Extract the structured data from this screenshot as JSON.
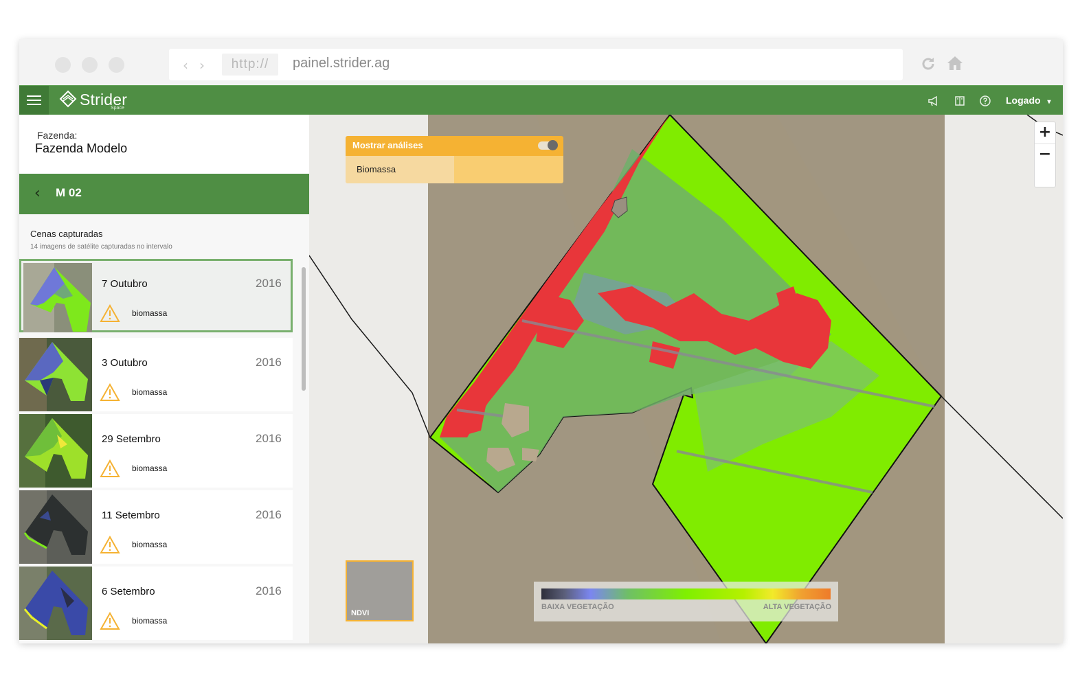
{
  "browser": {
    "protocol": "http://",
    "url": "painel.strider.ag"
  },
  "appbar": {
    "brand": "Strider",
    "brand_sub": "Space",
    "user_label": "Logado",
    "user_caret": "▾",
    "icons": [
      "megaphone-icon",
      "book-icon",
      "help-icon"
    ]
  },
  "sidebar": {
    "farm_label": "Fazenda:",
    "farm_name": "Fazenda Modelo",
    "field_back": "‹",
    "field_name": "M 02",
    "scenes_title": "Cenas capturadas",
    "scenes_subtitle": "14 imagens de satélite capturadas no intervalo",
    "scenes": [
      {
        "date": "7 Outubro",
        "year": "2016",
        "tag": "biomassa",
        "selected": true
      },
      {
        "date": "3 Outubro",
        "year": "2016",
        "tag": "biomassa"
      },
      {
        "date": "29 Setembro",
        "year": "2016",
        "tag": "biomassa"
      },
      {
        "date": "11 Setembro",
        "year": "2016",
        "tag": "biomassa"
      },
      {
        "date": "6 Setembro",
        "year": "2016",
        "tag": "biomassa"
      }
    ]
  },
  "map": {
    "analyses_title": "Mostrar análises",
    "analyses_toggle_on": true,
    "analysis_item": "Biomassa",
    "zoom_in": "+",
    "zoom_out": "−",
    "layer_label": "NDVI",
    "legend_low": "BAIXA VEGETAÇÃO",
    "legend_high": "ALTA VEGETAÇÃO"
  },
  "colors": {
    "brand_green": "#4f8e44",
    "accent_orange": "#f5b233",
    "vegetation_high": "#7ff000",
    "vegetation_low": "#e63a32"
  }
}
